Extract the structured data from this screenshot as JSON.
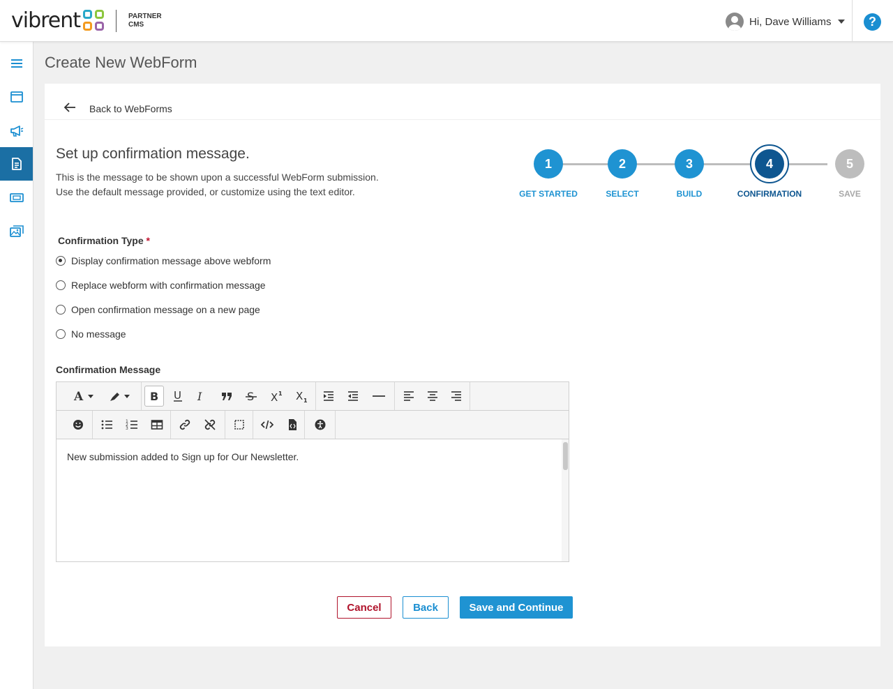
{
  "header": {
    "logo_text": "vibrent",
    "logo_sub_line1": "PARTNER",
    "logo_sub_line2": "CMS",
    "user_greeting": "Hi, Dave Williams",
    "help_label": "?"
  },
  "page": {
    "title": "Create New WebForm"
  },
  "card": {
    "back_label": "Back to WebForms",
    "section_title": "Set up confirmation message.",
    "section_desc_line1": "This is the message to be shown upon a successful WebForm submission.",
    "section_desc_line2": "Use the default message provided, or customize using the text editor."
  },
  "stepper": {
    "steps": [
      {
        "number": "1",
        "label": "GET STARTED",
        "state": "complete"
      },
      {
        "number": "2",
        "label": "SELECT",
        "state": "complete"
      },
      {
        "number": "3",
        "label": "BUILD",
        "state": "complete"
      },
      {
        "number": "4",
        "label": "CONFIRMATION",
        "state": "current"
      },
      {
        "number": "5",
        "label": "SAVE",
        "state": "upcoming"
      }
    ]
  },
  "confirmation_type": {
    "label": "Confirmation Type",
    "required_mark": "*",
    "options": [
      {
        "label": "Display confirmation message above webform",
        "checked": true
      },
      {
        "label": "Replace webform with confirmation message",
        "checked": false
      },
      {
        "label": "Open confirmation message on a new page",
        "checked": false
      },
      {
        "label": "No message",
        "checked": false
      }
    ]
  },
  "confirmation_message": {
    "label": "Confirmation Message",
    "content": "New submission added to Sign up for Our Newsletter."
  },
  "buttons": {
    "cancel": "Cancel",
    "back": "Back",
    "save": "Save and Continue"
  },
  "colors": {
    "brand_blue": "#1f93d2",
    "active_step": "#0e5690",
    "sidebar_active": "#1b6fa4",
    "cancel_red": "#b0132b",
    "upcoming_step": "#bdbdbd"
  }
}
